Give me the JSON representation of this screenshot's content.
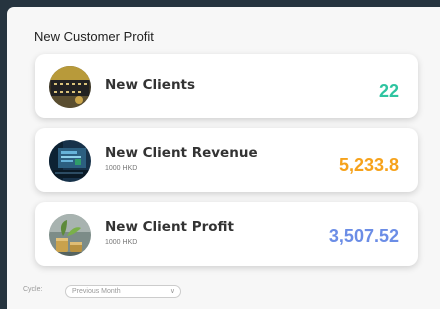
{
  "panel": {
    "title": "New Customer Profit"
  },
  "cards": [
    {
      "label": "New Clients",
      "sub": "",
      "value": "22",
      "value_color": "#2ec4a0",
      "avatar": "microchip-photo"
    },
    {
      "label": "New Client Revenue",
      "sub": "1000 HKD",
      "value": "5,233.8",
      "value_color": "#f6a21b",
      "avatar": "laptop-photo"
    },
    {
      "label": "New Client Profit",
      "sub": "1000 HKD",
      "value": "3,507.52",
      "value_color": "#6b8de6",
      "avatar": "coins-plant-photo"
    }
  ],
  "footer": {
    "cycle_label": "Cycle:",
    "cycle_value": "Previous Month",
    "chevron_icon": "chevron-down-icon"
  }
}
